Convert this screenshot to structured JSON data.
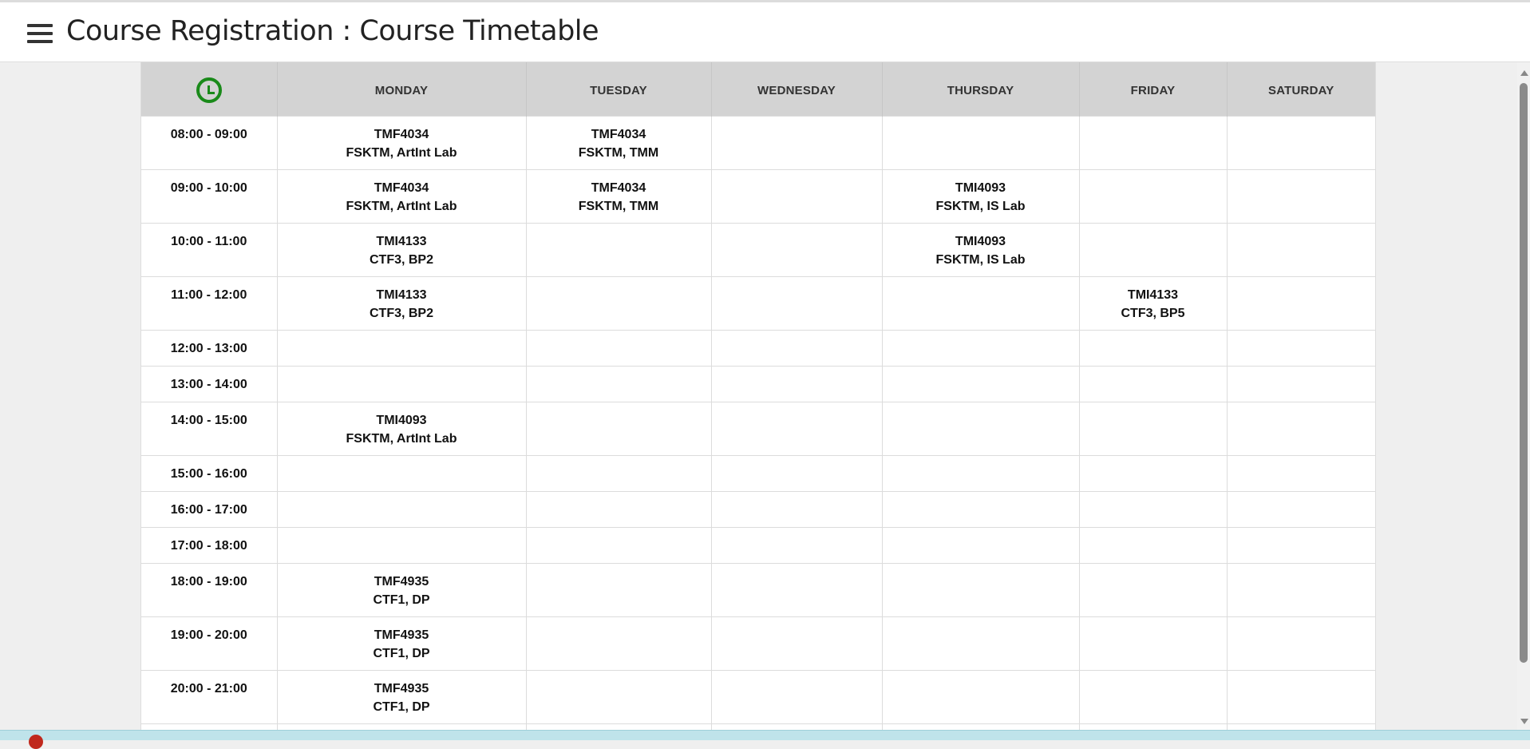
{
  "header": {
    "title": "Course Registration : Course Timetable",
    "menu_icon": "hamburger-menu-icon"
  },
  "timetable": {
    "corner_icon": "clock-icon",
    "clock_color": "#1a8a1a",
    "days": [
      "MONDAY",
      "TUESDAY",
      "WEDNESDAY",
      "THURSDAY",
      "FRIDAY",
      "SATURDAY"
    ],
    "rows": [
      {
        "time": "08:00 - 09:00",
        "cells": [
          {
            "code": "TMF4034",
            "venue": "FSKTM, ArtInt Lab"
          },
          {
            "code": "TMF4034",
            "venue": "FSKTM, TMM"
          },
          {
            "code": "",
            "venue": ""
          },
          {
            "code": "",
            "venue": ""
          },
          {
            "code": "",
            "venue": ""
          },
          {
            "code": "",
            "venue": ""
          }
        ]
      },
      {
        "time": "09:00 - 10:00",
        "cells": [
          {
            "code": "TMF4034",
            "venue": "FSKTM, ArtInt Lab"
          },
          {
            "code": "TMF4034",
            "venue": "FSKTM, TMM"
          },
          {
            "code": "",
            "venue": ""
          },
          {
            "code": "TMI4093",
            "venue": "FSKTM, IS Lab"
          },
          {
            "code": "",
            "venue": ""
          },
          {
            "code": "",
            "venue": ""
          }
        ]
      },
      {
        "time": "10:00 - 11:00",
        "cells": [
          {
            "code": "TMI4133",
            "venue": "CTF3, BP2"
          },
          {
            "code": "",
            "venue": ""
          },
          {
            "code": "",
            "venue": ""
          },
          {
            "code": "TMI4093",
            "venue": "FSKTM, IS Lab"
          },
          {
            "code": "",
            "venue": ""
          },
          {
            "code": "",
            "venue": ""
          }
        ]
      },
      {
        "time": "11:00 - 12:00",
        "cells": [
          {
            "code": "TMI4133",
            "venue": "CTF3, BP2"
          },
          {
            "code": "",
            "venue": ""
          },
          {
            "code": "",
            "venue": ""
          },
          {
            "code": "",
            "venue": ""
          },
          {
            "code": "TMI4133",
            "venue": "CTF3, BP5"
          },
          {
            "code": "",
            "venue": ""
          }
        ]
      },
      {
        "time": "12:00 - 13:00",
        "cells": [
          {
            "code": "",
            "venue": ""
          },
          {
            "code": "",
            "venue": ""
          },
          {
            "code": "",
            "venue": ""
          },
          {
            "code": "",
            "venue": ""
          },
          {
            "code": "",
            "venue": ""
          },
          {
            "code": "",
            "venue": ""
          }
        ]
      },
      {
        "time": "13:00 - 14:00",
        "cells": [
          {
            "code": "",
            "venue": ""
          },
          {
            "code": "",
            "venue": ""
          },
          {
            "code": "",
            "venue": ""
          },
          {
            "code": "",
            "venue": ""
          },
          {
            "code": "",
            "venue": ""
          },
          {
            "code": "",
            "venue": ""
          }
        ]
      },
      {
        "time": "14:00 - 15:00",
        "cells": [
          {
            "code": "TMI4093",
            "venue": "FSKTM, ArtInt Lab"
          },
          {
            "code": "",
            "venue": ""
          },
          {
            "code": "",
            "venue": ""
          },
          {
            "code": "",
            "venue": ""
          },
          {
            "code": "",
            "venue": ""
          },
          {
            "code": "",
            "venue": ""
          }
        ]
      },
      {
        "time": "15:00 - 16:00",
        "cells": [
          {
            "code": "",
            "venue": ""
          },
          {
            "code": "",
            "venue": ""
          },
          {
            "code": "",
            "venue": ""
          },
          {
            "code": "",
            "venue": ""
          },
          {
            "code": "",
            "venue": ""
          },
          {
            "code": "",
            "venue": ""
          }
        ]
      },
      {
        "time": "16:00 - 17:00",
        "cells": [
          {
            "code": "",
            "venue": ""
          },
          {
            "code": "",
            "venue": ""
          },
          {
            "code": "",
            "venue": ""
          },
          {
            "code": "",
            "venue": ""
          },
          {
            "code": "",
            "venue": ""
          },
          {
            "code": "",
            "venue": ""
          }
        ]
      },
      {
        "time": "17:00 - 18:00",
        "cells": [
          {
            "code": "",
            "venue": ""
          },
          {
            "code": "",
            "venue": ""
          },
          {
            "code": "",
            "venue": ""
          },
          {
            "code": "",
            "venue": ""
          },
          {
            "code": "",
            "venue": ""
          },
          {
            "code": "",
            "venue": ""
          }
        ]
      },
      {
        "time": "18:00 - 19:00",
        "cells": [
          {
            "code": "TMF4935",
            "venue": "CTF1, DP"
          },
          {
            "code": "",
            "venue": ""
          },
          {
            "code": "",
            "venue": ""
          },
          {
            "code": "",
            "venue": ""
          },
          {
            "code": "",
            "venue": ""
          },
          {
            "code": "",
            "venue": ""
          }
        ]
      },
      {
        "time": "19:00 - 20:00",
        "cells": [
          {
            "code": "TMF4935",
            "venue": "CTF1, DP"
          },
          {
            "code": "",
            "venue": ""
          },
          {
            "code": "",
            "venue": ""
          },
          {
            "code": "",
            "venue": ""
          },
          {
            "code": "",
            "venue": ""
          },
          {
            "code": "",
            "venue": ""
          }
        ]
      },
      {
        "time": "20:00 - 21:00",
        "cells": [
          {
            "code": "TMF4935",
            "venue": "CTF1, DP"
          },
          {
            "code": "",
            "venue": ""
          },
          {
            "code": "",
            "venue": ""
          },
          {
            "code": "",
            "venue": ""
          },
          {
            "code": "",
            "venue": ""
          },
          {
            "code": "",
            "venue": ""
          }
        ]
      },
      {
        "time": "",
        "cells": [
          {
            "code": "",
            "venue": ""
          },
          {
            "code": "",
            "venue": ""
          },
          {
            "code": "",
            "venue": ""
          },
          {
            "code": "",
            "venue": ""
          },
          {
            "code": "",
            "venue": ""
          },
          {
            "code": "",
            "venue": ""
          }
        ]
      }
    ]
  },
  "footer": {
    "alert_icon": "error-alert-icon",
    "alert_color": "#c0281c"
  }
}
